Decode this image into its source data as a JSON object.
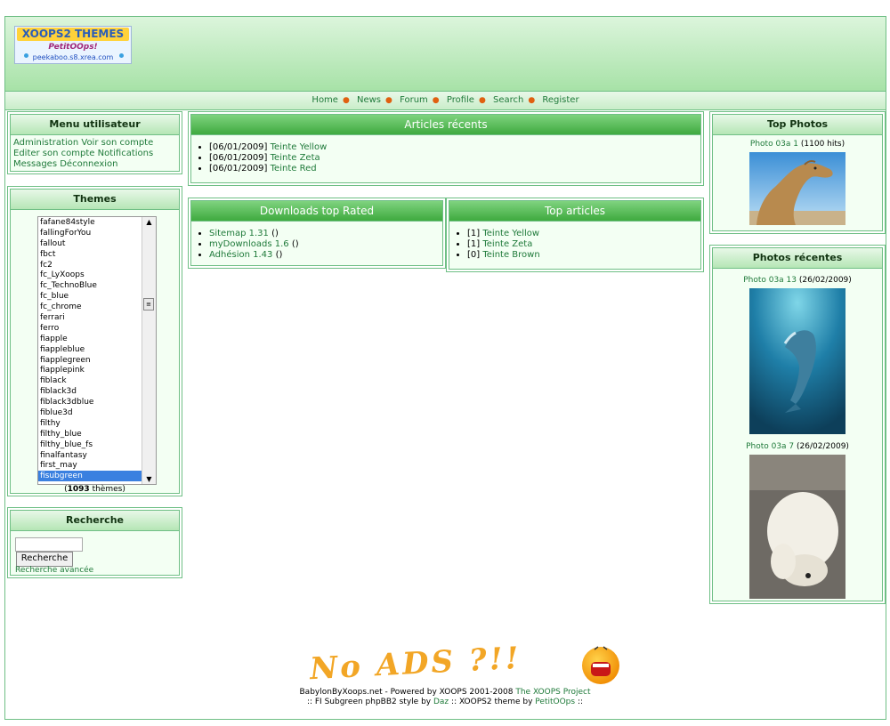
{
  "logo": {
    "line1": "XOOPS2 THEMES",
    "line2": "PetitOOps!",
    "line3": "peekaboo.s8.xrea.com"
  },
  "nav": [
    "Home",
    "News",
    "Forum",
    "Profile",
    "Search",
    "Register"
  ],
  "user_menu": {
    "title": "Menu utilisateur",
    "items": [
      "Administration",
      "Voir son compte",
      "Editer son compte",
      "Notifications",
      "Messages",
      "Déconnexion"
    ]
  },
  "themes": {
    "title": "Themes",
    "options": [
      "fafane84style",
      "fallingForYou",
      "fallout",
      "fbct",
      "fc2",
      "fc_LyXoops",
      "fc_TechnoBlue",
      "fc_blue",
      "fc_chrome",
      "ferrari",
      "ferro",
      "fiapple",
      "fiappleblue",
      "fiapplegreen",
      "fiapplepink",
      "fiblack",
      "fiblack3d",
      "fiblack3dblue",
      "fiblue3d",
      "filthy",
      "filthy_blue",
      "filthy_blue_fs",
      "finalfantasy",
      "first_may",
      "fisubgreen"
    ],
    "selected": "fisubgreen",
    "count": "1093",
    "count_suffix": "thèmes"
  },
  "search": {
    "title": "Recherche",
    "button": "Recherche",
    "advanced": "Recherche avancée",
    "value": ""
  },
  "recent_articles": {
    "title": "Articles récents",
    "items": [
      {
        "date": "[06/01/2009]",
        "title": "Teinte Yellow"
      },
      {
        "date": "[06/01/2009]",
        "title": "Teinte Zeta"
      },
      {
        "date": "[06/01/2009]",
        "title": "Teinte Red"
      }
    ]
  },
  "downloads": {
    "title": "Downloads top Rated",
    "items": [
      {
        "name": "Sitemap 1.31",
        "extra": "()"
      },
      {
        "name": "myDownloads 1.6",
        "extra": "()"
      },
      {
        "name": "Adhésion 1.43",
        "extra": "()"
      }
    ]
  },
  "top_articles": {
    "title": "Top articles",
    "items": [
      {
        "count": "[1]",
        "title": "Teinte Yellow"
      },
      {
        "count": "[1]",
        "title": "Teinte Zeta"
      },
      {
        "count": "[0]",
        "title": "Teinte Brown"
      }
    ]
  },
  "top_photos": {
    "title": "Top Photos",
    "photo": {
      "name": "Photo 03a 1",
      "hits": "(1100 hits)",
      "image": "camel"
    }
  },
  "recent_photos": {
    "title": "Photos récentes",
    "photos": [
      {
        "name": "Photo 03a 13",
        "date": "(26/02/2009)",
        "image": "dolphin"
      },
      {
        "name": "Photo 03a 7",
        "date": "(26/02/2009)",
        "image": "polar-bear"
      }
    ]
  },
  "ads": {
    "text": "No ADS ?!!"
  },
  "footer": {
    "line1_prefix": "BabylonByXoops.net - Powered by XOOPS 2001-2008",
    "line1_link": "The XOOPS Project",
    "line2_a": ":: FI Subgreen phpBB2 style by",
    "line2_link1": "Daz",
    "line2_b": ":: XOOPS2 theme by",
    "line2_link2": "PetitOOps",
    "line2_c": "::"
  },
  "colors": {
    "accent": "#3faa3f",
    "border": "#6fbf85",
    "link": "#1f7a3a",
    "nav_sep": "#e06010",
    "selected": "#3a80e0"
  }
}
